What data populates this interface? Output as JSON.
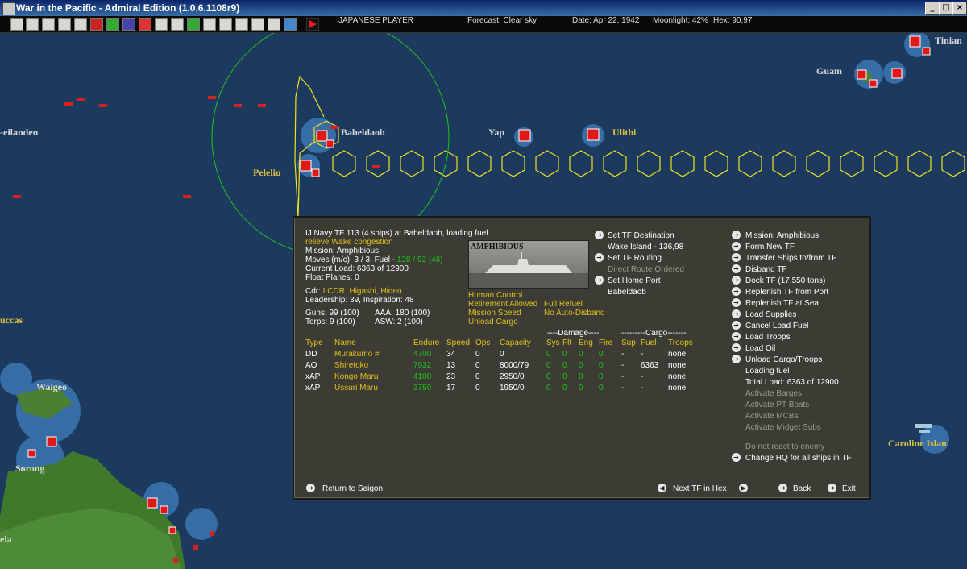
{
  "window": {
    "title": "War in the Pacific - Admiral Edition (1.0.6.1108r9)",
    "min": "_",
    "max": "□",
    "close": "×"
  },
  "status": {
    "player": "JAPANESE PLAYER",
    "forecast": "Forecast: Clear sky",
    "date": "Date: Apr 22, 1942",
    "moonlight": "Moonlight: 42%",
    "hex": "Hex: 90,97"
  },
  "map": {
    "labels": {
      "guam": "Guam",
      "tinian": "Tinian",
      "eilanden": "-eilanden",
      "babeldaob": "Babeldaob",
      "yap": "Yap",
      "ulithi": "Ulithi",
      "peleliu": "Peleliu",
      "uccas": "uccas",
      "waigeo": "Waigeo",
      "sorong": "Sorong",
      "caroline": "Caroline Islan",
      "ela": "ela"
    },
    "colors": {
      "sea": "#1c3a5e",
      "route": "#f0e020",
      "radius": "#20c020",
      "base": "#e01818"
    }
  },
  "tf": {
    "header": "IJ Navy TF 113 (4 ships) at Babeldaob, loading fuel",
    "note": "relieve Wake congestion",
    "mission": "Mission: Amphibious",
    "moves_prefix": "Moves (m/c): 3 / 3, Fuel - ",
    "moves_fuel": "128 / 92 (46)",
    "current_load": "Current Load: 6363 of 12900",
    "float_planes": "Float Planes: 0",
    "cdr_label": "Cdr:",
    "cdr_name": "LCDR. Higashi, Hideo",
    "leadership": "Leadership: 39, Inspiration: 48",
    "guns": "Guns: 99 (100)",
    "aaa": "AAA: 180 (100)",
    "torps": "Torps: 9 (100)",
    "asw": "ASW: 2 (100)",
    "photo_label": "AMPHIBIOUS",
    "control": "Human Control",
    "retirement": "Retirement Allowed",
    "refuel": "Full Refuel",
    "speed": "Mission Speed",
    "disband": "No Auto-Disband",
    "unload": "Unload Cargo"
  },
  "dest": {
    "set_dest": "Set TF Destination",
    "dest_value": "Wake Island - 136,98",
    "set_routing": "Set TF Routing",
    "routing_value": "Direct Route Ordered",
    "set_home": "Set Home Port",
    "home_value": "Babeldaob"
  },
  "table": {
    "damage_group": "----Damage----",
    "cargo_group": "---------Cargo-------",
    "headers": [
      "Type",
      "Name",
      "Endure",
      "Speed",
      "Ops",
      "Capacity",
      "Sys",
      "Flt",
      "Eng",
      "Fire",
      "Sup",
      "Fuel",
      "Troops"
    ],
    "rows": [
      [
        "DD",
        "Murakumo #",
        "4700",
        "34",
        "0",
        "0",
        "0",
        "0",
        "0",
        "0",
        "-",
        "-",
        "none"
      ],
      [
        "AO",
        "Shiretoko",
        "7932",
        "13",
        "0",
        "8000/79",
        "0",
        "0",
        "0",
        "0",
        "-",
        "6363",
        "none"
      ],
      [
        "xAP",
        "Kongo Maru",
        "4100",
        "23",
        "0",
        "2950/0",
        "0",
        "0",
        "0",
        "0",
        "-",
        "-",
        "none"
      ],
      [
        "xAP",
        "Ussuri Maru",
        "3750",
        "17",
        "0",
        "1950/0",
        "0",
        "0",
        "0",
        "0",
        "-",
        "-",
        "none"
      ]
    ]
  },
  "actions": {
    "mission": "Mission: Amphibious",
    "form_new": "Form New TF",
    "transfer": "Transfer Ships to/from TF",
    "disband": "Disband TF",
    "dock": "Dock TF (17,550 tons)",
    "replenish_port": "Replenish TF from Port",
    "replenish_sea": "Replenish TF at Sea",
    "load_supplies": "Load Supplies",
    "cancel_fuel": "Cancel Load Fuel",
    "load_troops": "Load Troops",
    "load_oil": "Load Oil",
    "unload": "Unload Cargo/Troops",
    "loading_fuel": "Loading fuel",
    "total_load": "Total Load: 6363 of 12900",
    "barges": "Activate Barges",
    "pt": "Activate PT Boats",
    "mcbs": "Activate MCBs",
    "midget": "Activate Midget Subs",
    "no_react": "Do not react to enemy",
    "change_hq": "Change HQ for all ships in TF"
  },
  "footer": {
    "return": "Return to Saigon",
    "next": "Next TF in Hex",
    "back": "Back",
    "exit": "Exit"
  }
}
